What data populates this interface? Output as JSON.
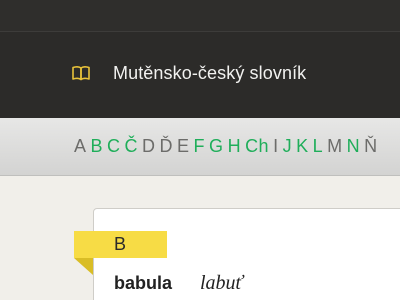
{
  "header": {
    "title": "Mutěnsko-český slovník",
    "icon": "book-icon",
    "accent": "#e8c23a"
  },
  "alphabet": {
    "letters": [
      {
        "label": "A",
        "active": false
      },
      {
        "label": "B",
        "active": true
      },
      {
        "label": "C",
        "active": true
      },
      {
        "label": "Č",
        "active": true
      },
      {
        "label": "D",
        "active": false
      },
      {
        "label": "Ď",
        "active": false
      },
      {
        "label": "E",
        "active": false
      },
      {
        "label": "F",
        "active": true
      },
      {
        "label": "G",
        "active": true
      },
      {
        "label": "H",
        "active": true
      },
      {
        "label": "Ch",
        "active": true
      },
      {
        "label": "I",
        "active": false
      },
      {
        "label": "J",
        "active": true
      },
      {
        "label": "K",
        "active": true
      },
      {
        "label": "L",
        "active": true
      },
      {
        "label": "M",
        "active": false
      },
      {
        "label": "N",
        "active": true
      },
      {
        "label": "Ň",
        "active": false
      }
    ],
    "active_color": "#1fae5a",
    "inactive_color": "#6c6c6a"
  },
  "section": {
    "letter": "B",
    "tag_color": "#f7dc45"
  },
  "entries": [
    {
      "word": "babula",
      "translation": "labuť"
    }
  ]
}
